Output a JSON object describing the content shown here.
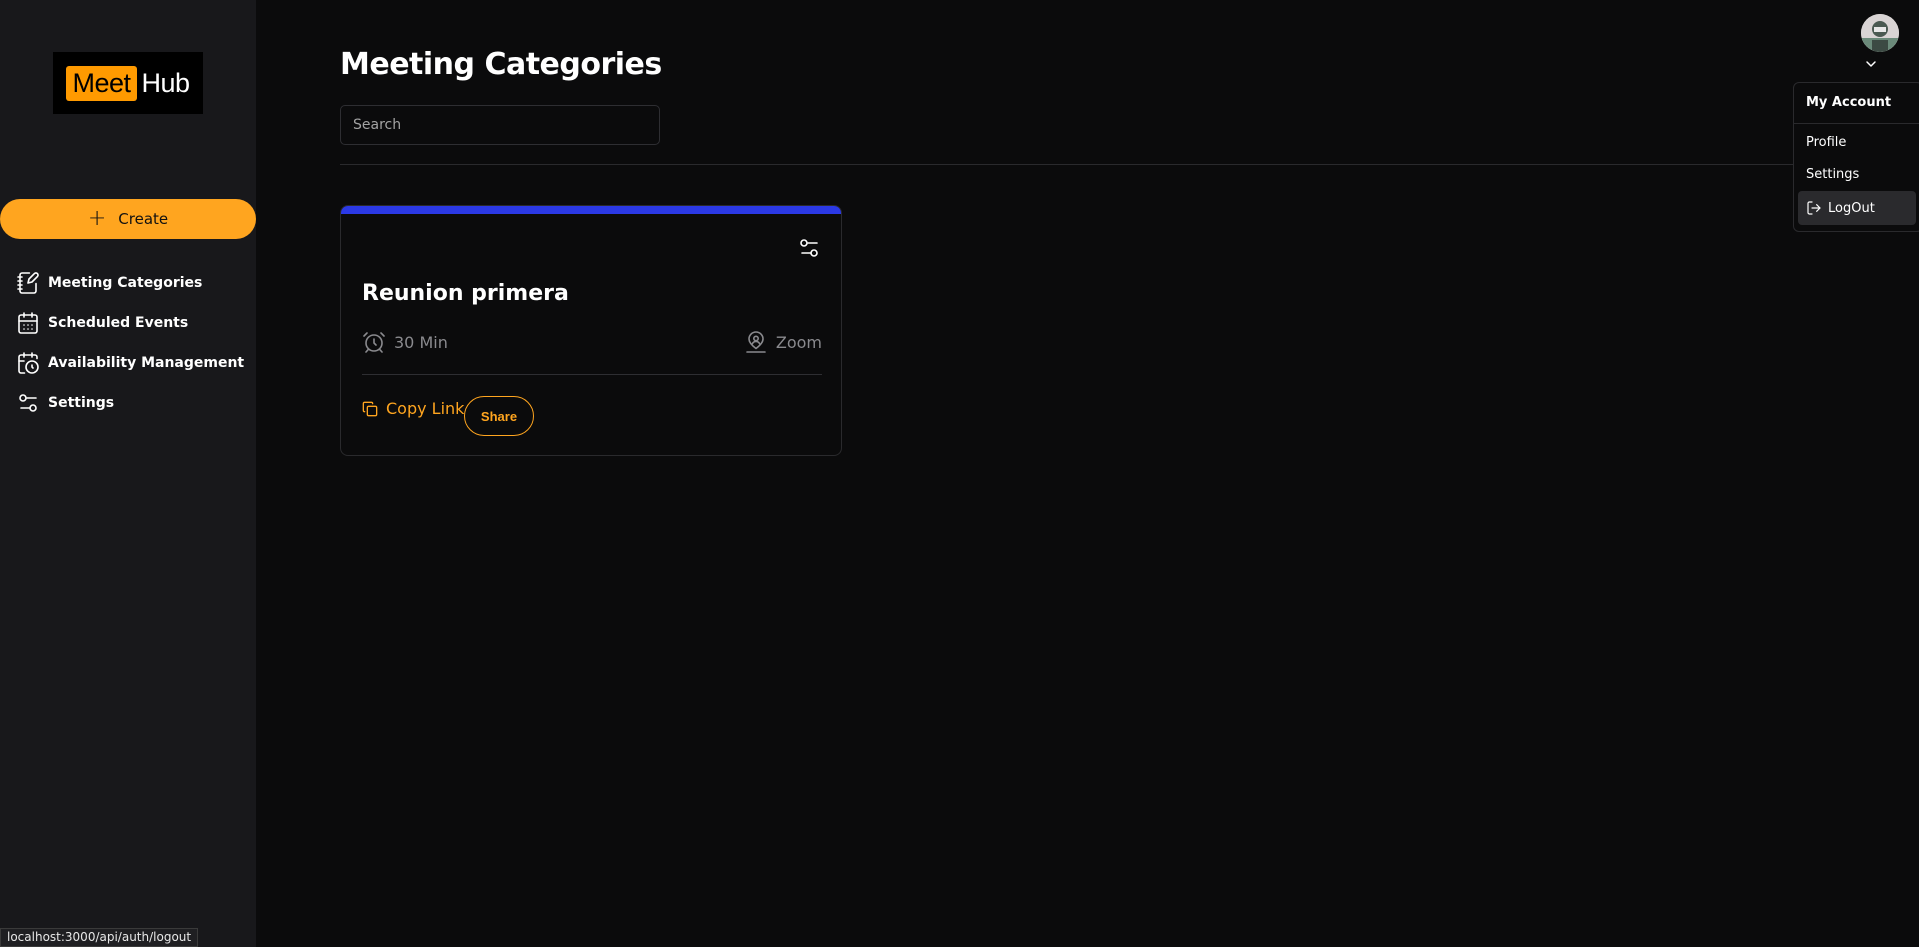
{
  "sidebar": {
    "logo": {
      "part1": "Meet",
      "part2": "Hub"
    },
    "create_label": "Create",
    "items": [
      {
        "label": "Meeting Categories",
        "icon": "notebook-pen-icon"
      },
      {
        "label": "Scheduled Events",
        "icon": "calendar-icon"
      },
      {
        "label": "Availability Management",
        "icon": "calendar-clock-icon"
      },
      {
        "label": "Settings",
        "icon": "settings-sliders-icon"
      }
    ]
  },
  "main": {
    "title": "Meeting Categories",
    "search": {
      "placeholder": "Search",
      "value": ""
    },
    "cards": [
      {
        "title": "Reunion primera",
        "duration": "30 Min",
        "location": "Zoom",
        "accent_color": "#2b39e6",
        "copy_link_label": "Copy Link",
        "share_label": "Share"
      }
    ]
  },
  "user_menu": {
    "label": "My Account",
    "items": [
      "Profile",
      "Settings"
    ],
    "logout_label": "LogOut"
  },
  "status_bar": {
    "url": "localhost:3000/api/auth/logout"
  },
  "colors": {
    "accent": "#ffa51f",
    "card_accent": "#2b39e6",
    "sidebar_bg": "#18181b",
    "page_bg": "#0b0b0c"
  }
}
